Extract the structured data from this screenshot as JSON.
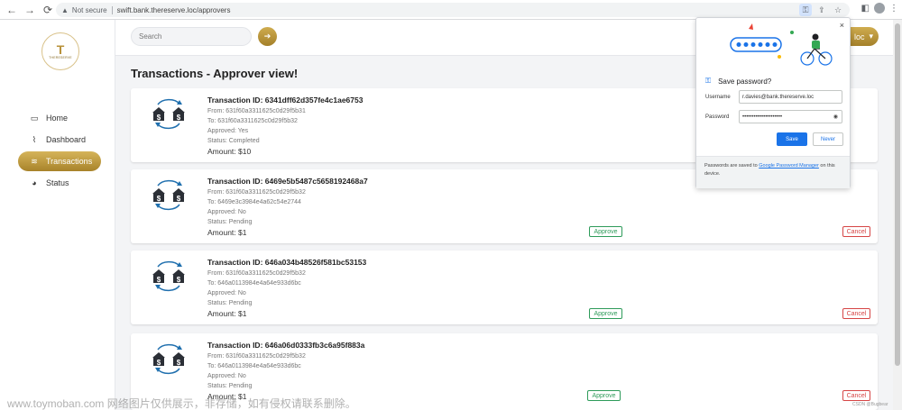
{
  "browser": {
    "security_label": "Not secure",
    "url": "swift.bank.thereserve.loc/approvers"
  },
  "logo": {
    "letter": "T",
    "name": "THERESERVE"
  },
  "sidebar": {
    "items": [
      {
        "label": "Home",
        "icon": "monitor-icon",
        "active": false
      },
      {
        "label": "Dashboard",
        "icon": "chart-line-icon",
        "active": false
      },
      {
        "label": "Transactions",
        "icon": "coins-icon",
        "active": true
      },
      {
        "label": "Status",
        "icon": "pie-chart-icon",
        "active": false
      }
    ]
  },
  "header": {
    "search_placeholder": "Search",
    "user_label": "loc"
  },
  "main": {
    "title": "Transactions - Approver view!",
    "transactions": [
      {
        "id": "Transaction ID: 6341dff62d357fe4c1ae6753",
        "from": "From: 631f60a3311625c0d29f5b31",
        "to": "To: 631f60a3311625c0d29f5b32",
        "approved": "Approved: Yes",
        "status": "Status: Completed",
        "amount": "Amount: $10",
        "has_actions": false
      },
      {
        "id": "Transaction ID: 6469e5b5487c5658192468a7",
        "from": "From: 631f60a3311625c0d29f5b32",
        "to": "To: 6469e3c3984e4a62c54e2744",
        "approved": "Approved: No",
        "status": "Status: Pending",
        "amount": "Amount: $1",
        "has_actions": true
      },
      {
        "id": "Transaction ID: 646a034b48526f581bc53153",
        "from": "From: 631f60a3311625c0d29f5b32",
        "to": "To: 646a0113984e4a64e933d6bc",
        "approved": "Approved: No",
        "status": "Status: Pending",
        "amount": "Amount: $1",
        "has_actions": true
      },
      {
        "id": "Transaction ID: 646a06d0333fb3c6a95f883a",
        "from": "From: 631f60a3311625c0d29f5b32",
        "to": "To: 646a0113984e4a64e933d6bc",
        "approved": "Approved: No",
        "status": "Status: Pending",
        "amount": "Amount: $1",
        "has_actions": true
      }
    ],
    "approve_label": "Approve",
    "cancel_label": "Cancel"
  },
  "password_popup": {
    "title": "Save password?",
    "username_label": "Username",
    "username_value": "r.davies@bank.thereserve.loc",
    "password_label": "Password",
    "password_value": "•••••••••••••••••••••",
    "save_label": "Save",
    "never_label": "Never",
    "footer_text": "Passwords are saved to",
    "footer_link": "Google Password Manager",
    "footer_text_end": "on this device.",
    "close_glyph": "×"
  },
  "watermark": {
    "text": "www.toymoban.com 网络图片仅供展示，非存储，如有侵权请联系删除。",
    "csdn": "CSDN @Bugbear"
  },
  "colors": {
    "gold": "#b8913a",
    "approve": "#2e9b5a",
    "cancel": "#d64545",
    "google_blue": "#1a73e8"
  }
}
